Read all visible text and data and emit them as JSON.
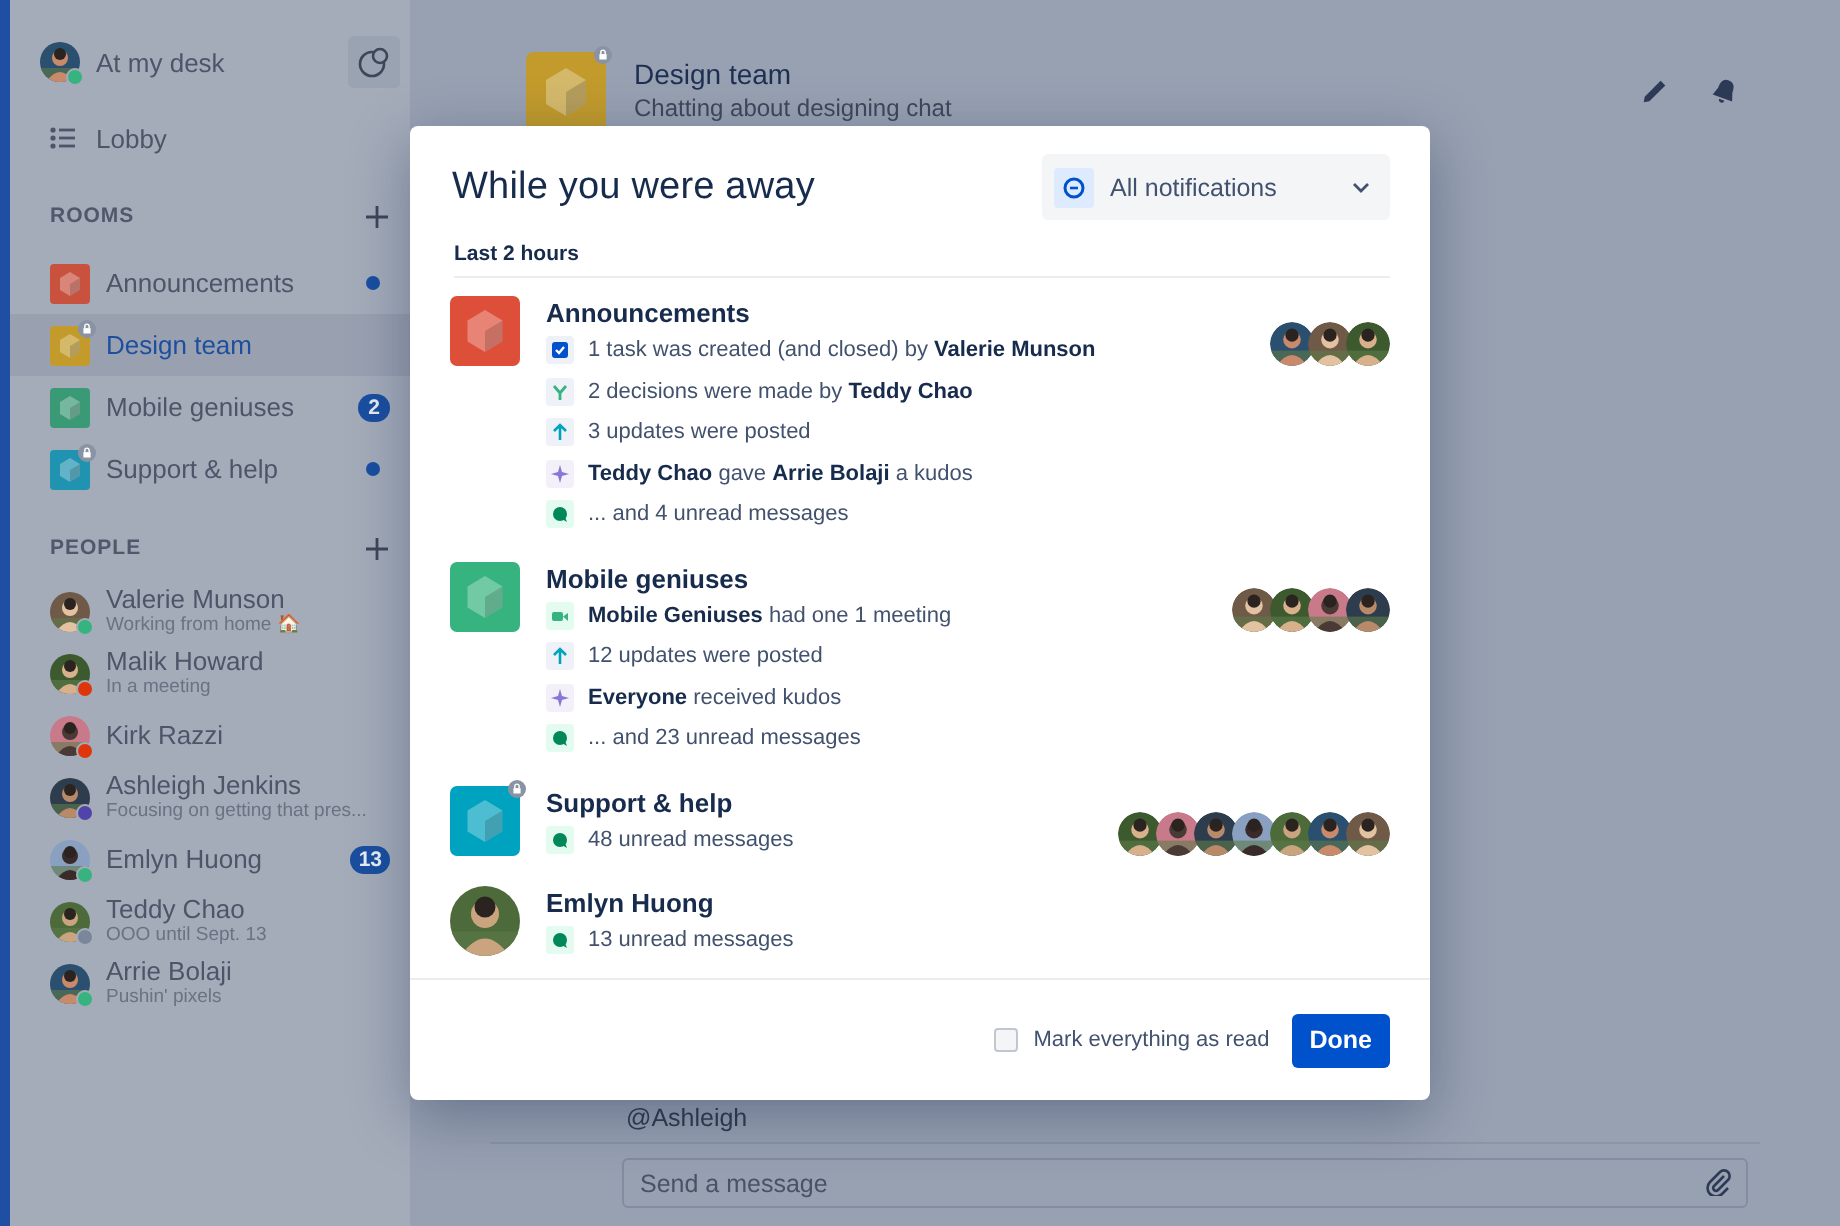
{
  "sidebar": {
    "status": {
      "label": "At my desk",
      "color": "#36b37e"
    },
    "lobby": "Lobby",
    "rooms": {
      "title": "ROOMS",
      "items": [
        {
          "name": "Announcements",
          "color": "#c9523f",
          "locked": false,
          "selected": false,
          "unread_dot": true
        },
        {
          "name": "Design team",
          "color": "#c29b2c",
          "locked": true,
          "selected": true,
          "unread_dot": false
        },
        {
          "name": "Mobile geniuses",
          "color": "#3b9a76",
          "locked": false,
          "selected": false,
          "unread_dot": false,
          "badge": "2"
        },
        {
          "name": "Support & help",
          "color": "#1f93b0",
          "locked": true,
          "selected": false,
          "unread_dot": true
        }
      ]
    },
    "people": {
      "title": "PEOPLE",
      "items": [
        {
          "name": "Valerie Munson",
          "status": "Working from home 🏠",
          "color": "#36b37e"
        },
        {
          "name": "Malik Howard",
          "status": "In a meeting",
          "color": "#de350b"
        },
        {
          "name": "Kirk Razzi",
          "color": "#de350b"
        },
        {
          "name": "Ashleigh Jenkins",
          "status": "Focusing on getting that pres...",
          "color": "#5243aa"
        },
        {
          "name": "Emlyn Huong",
          "color": "#36b37e",
          "badge": "13"
        },
        {
          "name": "Teddy Chao",
          "status": "OOO until Sept. 13",
          "color": "#7a869a"
        },
        {
          "name": "Arrie Bolaji",
          "status": "Pushin' pixels",
          "color": "#36b37e"
        }
      ]
    }
  },
  "room_header": {
    "title": "Design team",
    "subtitle": "Chatting about designing chat",
    "color": "#c29b2c",
    "locked": true
  },
  "mention": "@Ashleigh",
  "composer": {
    "placeholder": "Send a message"
  },
  "dialog": {
    "title": "While you were away",
    "filter": "All notifications",
    "section": "Last 2 hours",
    "groups": [
      {
        "name": "Announcements",
        "kind": "room",
        "color": "#de4f3a",
        "locked": false,
        "avatars": [
          {
            "kind": "picture"
          },
          {
            "kind": "picture"
          },
          {
            "kind": "picture"
          }
        ],
        "lines": [
          {
            "kind": "task",
            "text": "1 task was created (and closed) by **Valerie Munson**"
          },
          {
            "kind": "decision",
            "text": "2 decisions were made by **Teddy Chao**"
          },
          {
            "kind": "update",
            "text": "3 updates were posted"
          },
          {
            "kind": "kudos",
            "text": "**Teddy Chao** gave **Arrie Bolaji** a kudos"
          },
          {
            "kind": "message",
            "text": "... and 4 unread messages"
          }
        ]
      },
      {
        "name": "Mobile geniuses",
        "kind": "room",
        "color": "#36b37e",
        "locked": false,
        "avatars": [
          {
            "kind": "picture"
          },
          {
            "kind": "picture"
          },
          {
            "kind": "picture"
          },
          {
            "kind": "picture"
          }
        ],
        "lines": [
          {
            "kind": "meeting",
            "text": "**Mobile Geniuses** had one 1 meeting"
          },
          {
            "kind": "update",
            "text": "12 updates were posted"
          },
          {
            "kind": "kudos",
            "text": "**Everyone** received kudos"
          },
          {
            "kind": "message",
            "text": "... and 23 unread messages"
          }
        ]
      },
      {
        "name": "Support & help",
        "kind": "room",
        "color": "#00a3bf",
        "locked": true,
        "avatars": [
          {
            "kind": "picture"
          },
          {
            "kind": "picture"
          },
          {
            "kind": "picture"
          },
          {
            "kind": "picture"
          },
          {
            "kind": "picture"
          },
          {
            "kind": "picture"
          },
          {
            "kind": "picture"
          }
        ],
        "lines": [
          {
            "kind": "message",
            "text": "48 unread messages"
          }
        ]
      },
      {
        "name": "Emlyn Huong",
        "kind": "person",
        "lines": [
          {
            "kind": "message",
            "text": "13 unread messages"
          }
        ]
      }
    ],
    "mark_read": {
      "label": "Mark everything as read",
      "checked": false
    },
    "done": "Done"
  }
}
